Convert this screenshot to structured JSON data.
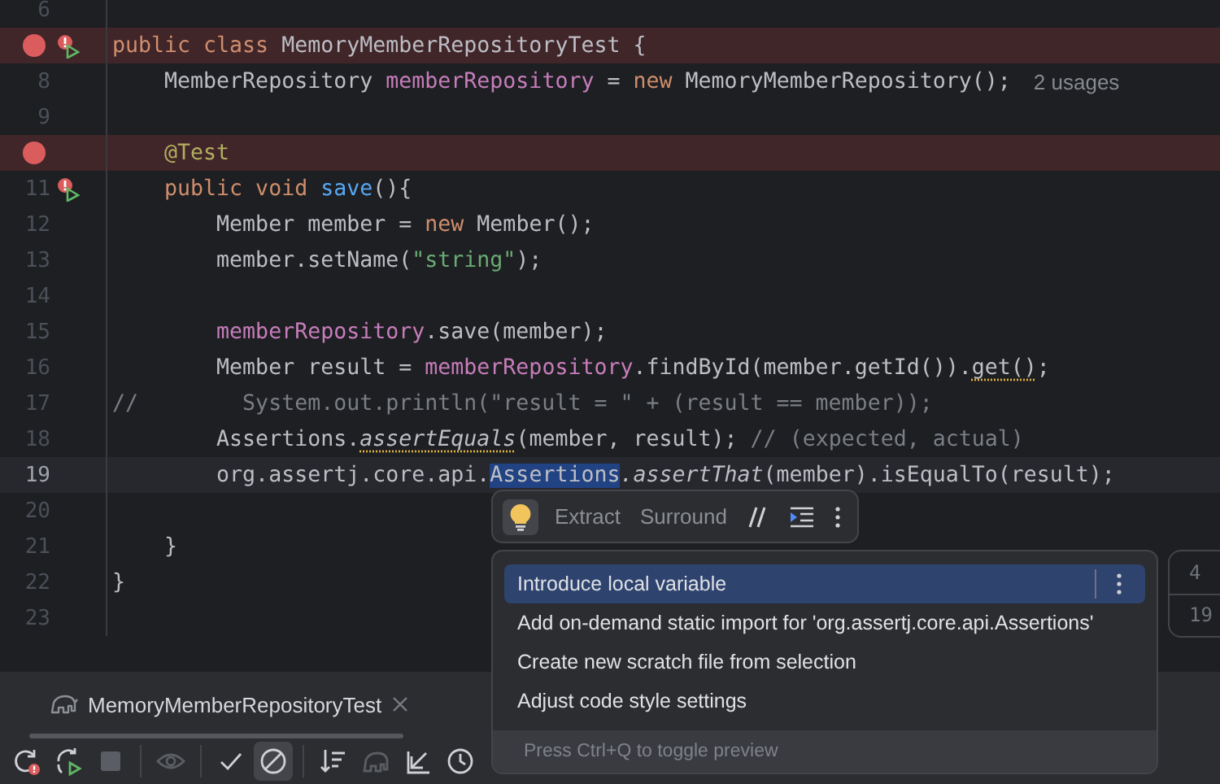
{
  "editor": {
    "lines": [
      {
        "number": "6",
        "breakpoint": false,
        "run": false,
        "highlighted": false,
        "current": false
      },
      {
        "breakpoint": true,
        "run": true,
        "highlighted": true,
        "current": false,
        "tokens": [
          {
            "kind": "keyword",
            "text": "public class "
          },
          {
            "kind": "plain",
            "text": "MemoryMemberRepositoryTest {"
          }
        ]
      },
      {
        "number": "8",
        "breakpoint": false,
        "run": false,
        "highlighted": false,
        "current": false,
        "tokens": [
          {
            "kind": "plain",
            "text": "    MemberRepository "
          },
          {
            "kind": "field",
            "text": "memberRepository"
          },
          {
            "kind": "plain",
            "text": " = "
          },
          {
            "kind": "keyword",
            "text": "new "
          },
          {
            "kind": "plain",
            "text": "MemoryMemberRepository();"
          }
        ],
        "hint": "2 usages"
      },
      {
        "number": "9",
        "breakpoint": false,
        "run": false,
        "highlighted": false,
        "current": false
      },
      {
        "breakpoint": true,
        "run": false,
        "highlighted": true,
        "current": false,
        "tokens": [
          {
            "kind": "annotation",
            "text": "    @Test"
          }
        ]
      },
      {
        "number": "11",
        "breakpoint": false,
        "run": true,
        "highlighted": false,
        "current": false,
        "tokens": [
          {
            "kind": "keyword",
            "text": "    public void "
          },
          {
            "kind": "method",
            "text": "save"
          },
          {
            "kind": "plain",
            "text": "(){"
          }
        ]
      },
      {
        "number": "12",
        "breakpoint": false,
        "run": false,
        "highlighted": false,
        "current": false,
        "tokens": [
          {
            "kind": "plain",
            "text": "        Member member = "
          },
          {
            "kind": "keyword",
            "text": "new "
          },
          {
            "kind": "plain",
            "text": "Member();"
          }
        ]
      },
      {
        "number": "13",
        "breakpoint": false,
        "run": false,
        "highlighted": false,
        "current": false,
        "tokens": [
          {
            "kind": "plain",
            "text": "        member.setName("
          },
          {
            "kind": "string",
            "text": "\"string\""
          },
          {
            "kind": "plain",
            "text": ");"
          }
        ]
      },
      {
        "number": "14",
        "breakpoint": false,
        "run": false,
        "highlighted": false,
        "current": false
      },
      {
        "number": "15",
        "breakpoint": false,
        "run": false,
        "highlighted": false,
        "current": false,
        "tokens": [
          {
            "kind": "field",
            "text": "        memberRepository"
          },
          {
            "kind": "plain",
            "text": ".save(member);"
          }
        ]
      },
      {
        "number": "16",
        "breakpoint": false,
        "run": false,
        "highlighted": false,
        "current": false,
        "tokens": [
          {
            "kind": "plain",
            "text": "        Member result = "
          },
          {
            "kind": "field",
            "text": "memberRepository"
          },
          {
            "kind": "plain",
            "text": ".findById(member.getId())."
          },
          {
            "kind": "warning",
            "text": "get()"
          },
          {
            "kind": "plain",
            "text": ";"
          }
        ]
      },
      {
        "number": "17",
        "breakpoint": false,
        "run": false,
        "highlighted": false,
        "current": false,
        "tokens": [
          {
            "kind": "comment",
            "text": "//        System.out.println(\"result = \" + (result == member));"
          }
        ]
      },
      {
        "number": "18",
        "breakpoint": false,
        "run": false,
        "highlighted": false,
        "current": false,
        "tokens": [
          {
            "kind": "plain",
            "text": "        Assertions."
          },
          {
            "kind": "static_warning",
            "text": "assertEquals"
          },
          {
            "kind": "plain",
            "text": "(member, result); "
          },
          {
            "kind": "comment",
            "text": "// (expected, actual)"
          }
        ]
      },
      {
        "number": "19",
        "breakpoint": false,
        "run": false,
        "highlighted": false,
        "current": true,
        "tokens": [
          {
            "kind": "plain",
            "text": "        org.assertj.core.api."
          },
          {
            "kind": "selection",
            "text": "Assertions"
          },
          {
            "kind": "static",
            "text": ".assertThat"
          },
          {
            "kind": "plain",
            "text": "(member).isEqualTo(result);"
          }
        ]
      },
      {
        "number": "20",
        "breakpoint": false,
        "run": false,
        "highlighted": false,
        "current": false
      },
      {
        "number": "21",
        "breakpoint": false,
        "run": false,
        "highlighted": false,
        "current": false,
        "tokens": [
          {
            "kind": "plain",
            "text": "    }"
          }
        ]
      },
      {
        "number": "22",
        "breakpoint": false,
        "run": false,
        "highlighted": false,
        "current": false,
        "tokens": [
          {
            "kind": "plain",
            "text": "}"
          }
        ]
      },
      {
        "number": "23",
        "breakpoint": false,
        "run": false,
        "highlighted": false,
        "current": false
      }
    ]
  },
  "intention_bar": {
    "actions": [
      "Extract",
      "Surround"
    ]
  },
  "intention_menu": {
    "items": [
      {
        "label": "Introduce local variable",
        "selected": true
      },
      {
        "label": "Add on-demand static import for 'org.assertj.core.api.Assertions'",
        "selected": false
      },
      {
        "label": "Create new scratch file from selection",
        "selected": false
      },
      {
        "label": "Adjust code style settings",
        "selected": false
      }
    ],
    "footer": "Press Ctrl+Q to toggle preview"
  },
  "preview_panel": {
    "cells": [
      "4",
      "19"
    ]
  },
  "run_panel": {
    "tab": {
      "label": "MemoryMemberRepositoryTest",
      "selected": true
    },
    "toolbar_groups": [
      [
        {
          "kind": "rerun",
          "disabled": false,
          "selected": false
        },
        {
          "kind": "rerun_failed",
          "disabled": false,
          "selected": false
        },
        {
          "kind": "stop",
          "disabled": true,
          "selected": false
        }
      ],
      [
        {
          "kind": "eye",
          "disabled": true,
          "selected": false
        }
      ],
      [
        {
          "kind": "check",
          "disabled": false,
          "selected": false
        },
        {
          "kind": "ignore",
          "disabled": false,
          "selected": true
        }
      ],
      [
        {
          "kind": "sort",
          "disabled": false,
          "selected": false
        },
        {
          "kind": "import",
          "disabled": true,
          "selected": false
        },
        {
          "kind": "export",
          "disabled": false,
          "selected": false
        },
        {
          "kind": "history",
          "disabled": false,
          "selected": false
        }
      ]
    ]
  }
}
